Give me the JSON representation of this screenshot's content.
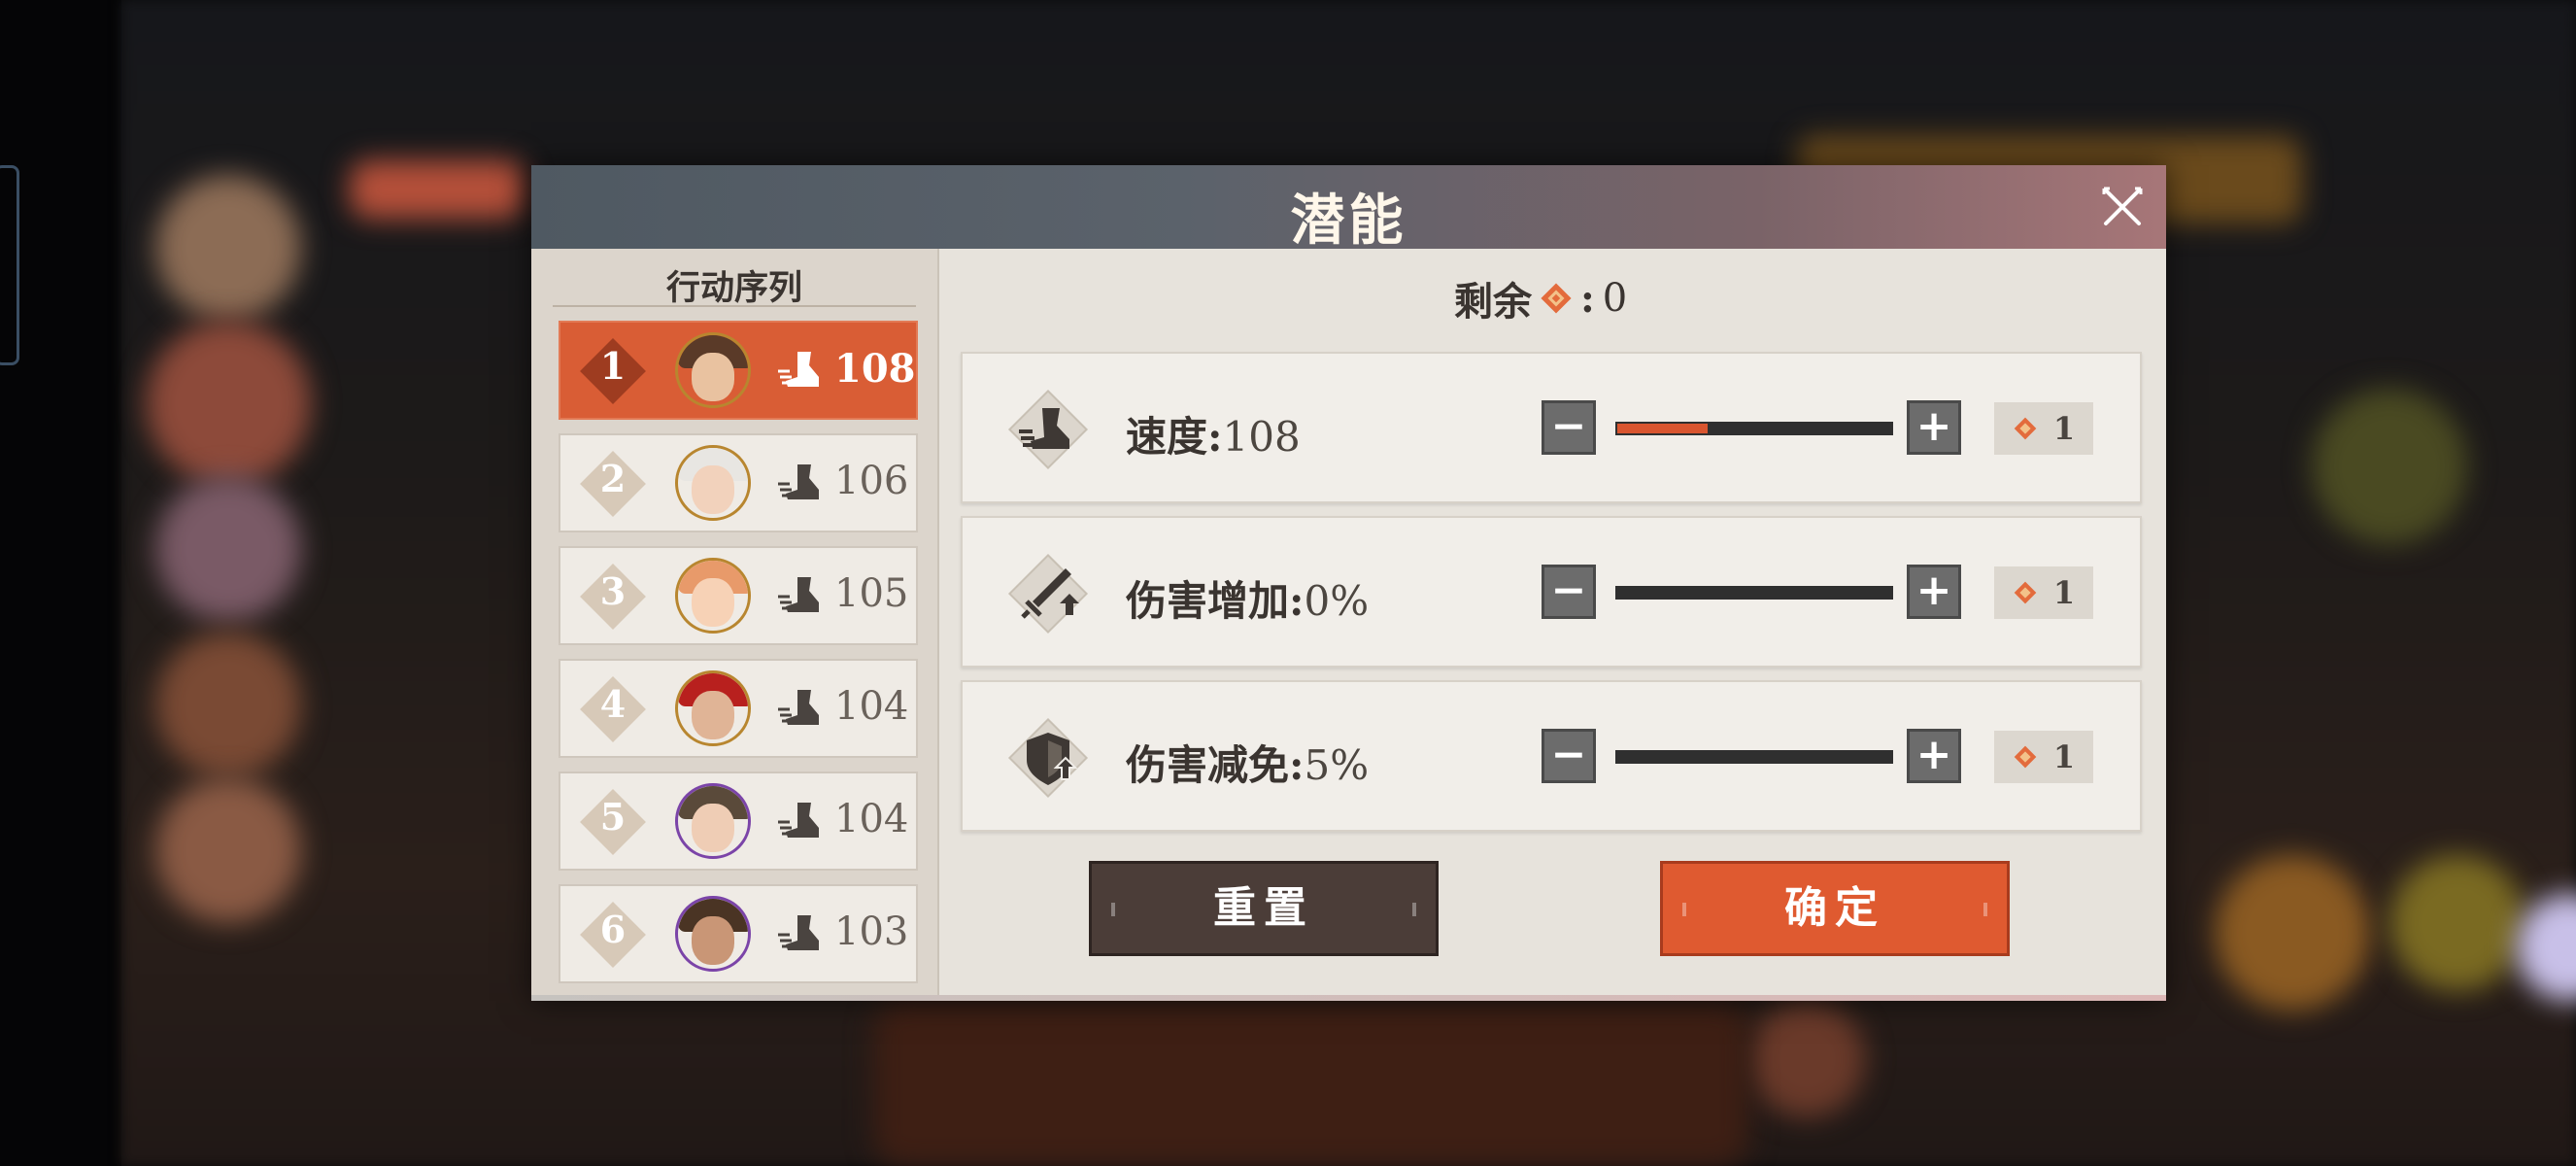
{
  "dialog": {
    "title": "潜能",
    "remaining_label": "剩余",
    "remaining_sep": ":",
    "remaining_value": "0"
  },
  "sequence": {
    "title": "行动序列",
    "rows": [
      {
        "rank": "1",
        "speed": "108",
        "active": true
      },
      {
        "rank": "2",
        "speed": "106",
        "active": false
      },
      {
        "rank": "3",
        "speed": "105",
        "active": false
      },
      {
        "rank": "4",
        "speed": "104",
        "active": false
      },
      {
        "rank": "5",
        "speed": "104",
        "active": false
      },
      {
        "rank": "6",
        "speed": "103",
        "active": false
      }
    ]
  },
  "stats": [
    {
      "label": "速度",
      "sep": ":",
      "value": "108",
      "cost": "1",
      "level_fraction": 0.33,
      "icon": "speed-icon"
    },
    {
      "label": "伤害增加",
      "sep": ":",
      "value": "0%",
      "cost": "1",
      "level_fraction": 0,
      "icon": "sword-up-icon"
    },
    {
      "label": "伤害减免",
      "sep": ":",
      "value": "5%",
      "cost": "1",
      "level_fraction": 0,
      "icon": "shield-up-icon"
    }
  ],
  "stepper": {
    "minus": "−",
    "plus": "+"
  },
  "buttons": {
    "reset": "重置",
    "confirm": "确定"
  },
  "colors": {
    "accent": "#d9552f",
    "header_start": "#4f5962",
    "header_end": "#a77678",
    "panel": "#e7e3dc"
  }
}
